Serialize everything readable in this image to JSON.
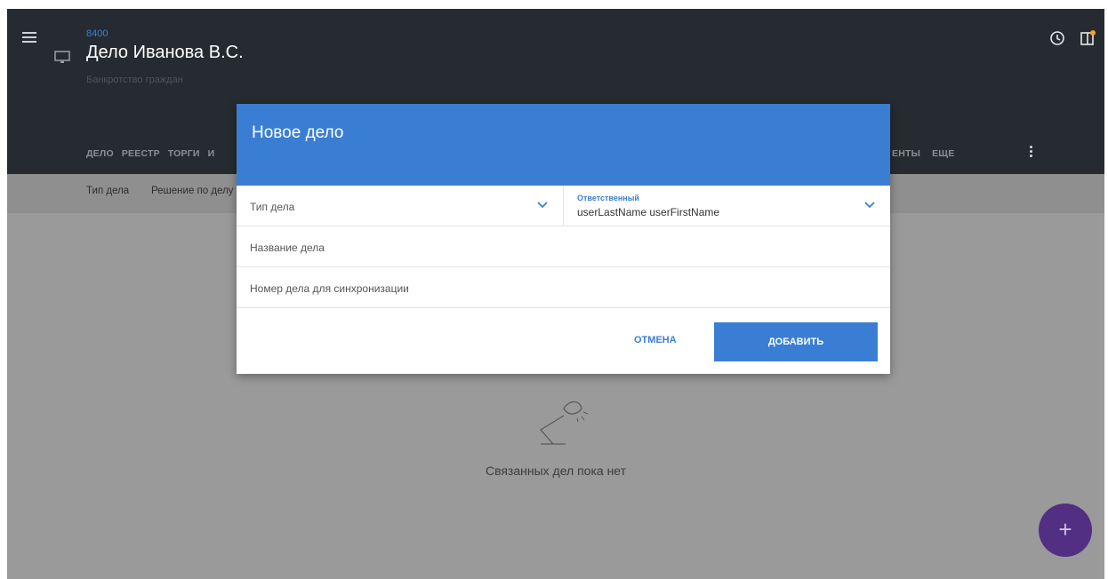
{
  "header": {
    "case_id": "8400",
    "case_title": "Дело Иванова В.С.",
    "case_subtitle": "Банкротство граждан",
    "tabs": [
      "ДЕЛО",
      "РЕЕСТР",
      "ТОРГИ",
      "И"
    ],
    "tabs_right": [
      "ЕНТЫ",
      "ЕЩЕ"
    ]
  },
  "subbar": {
    "items": [
      "Тип дела",
      "Решение по делу"
    ]
  },
  "empty_state": {
    "text": "Связанных дел пока нет"
  },
  "fab": {
    "label": "+"
  },
  "dialog": {
    "title": "Новое дело",
    "case_type_label": "Тип дела",
    "responsible_label": "Ответственный",
    "responsible_value": "userLastName userFirstName",
    "case_name_label": "Название дела",
    "sync_number_label": "Номер дела для синхронизации",
    "cancel_label": "ОТМЕНА",
    "add_label": "ДОБАВИТЬ"
  },
  "colors": {
    "accent": "#3a7ed3",
    "header_bg": "#262b31",
    "fab": "#532f83"
  }
}
